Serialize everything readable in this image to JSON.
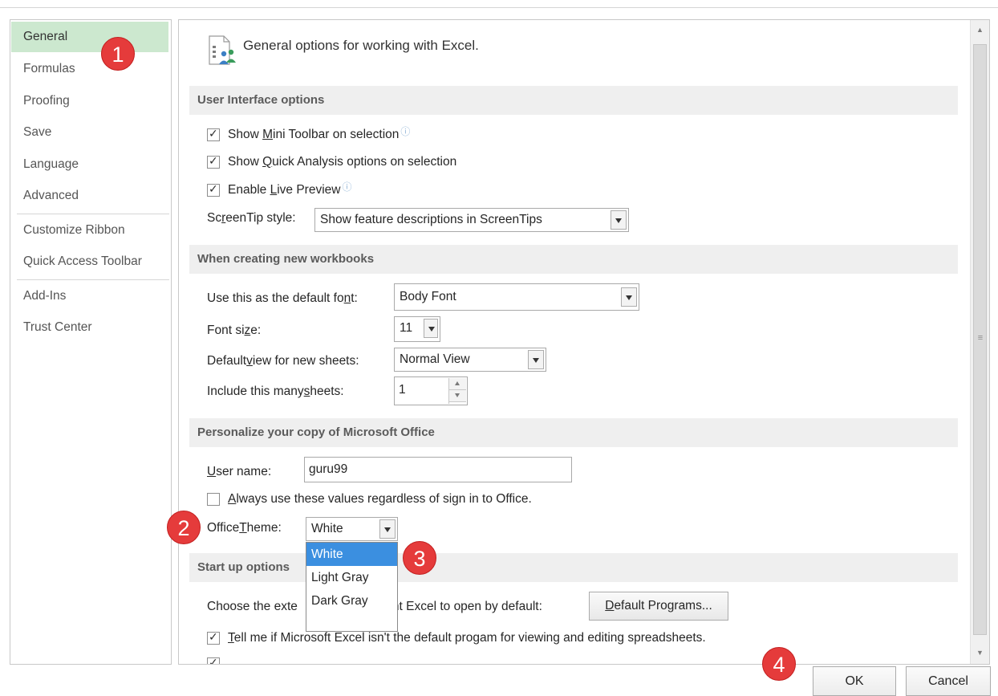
{
  "sidebar": {
    "items": [
      {
        "label": "General"
      },
      {
        "label": "Formulas"
      },
      {
        "label": "Proofing"
      },
      {
        "label": "Save"
      },
      {
        "label": "Language"
      },
      {
        "label": "Advanced"
      },
      {
        "label": "Customize Ribbon"
      },
      {
        "label": "Quick Access Toolbar"
      },
      {
        "label": "Add-Ins"
      },
      {
        "label": "Trust Center"
      }
    ],
    "selected": "General"
  },
  "header": {
    "title": "General options for working with Excel."
  },
  "sections": {
    "ui": "User Interface options",
    "workbooks": "When creating new workbooks",
    "personalize": "Personalize your copy of Microsoft Office",
    "startup": "Start up options"
  },
  "ui_options": {
    "mini_toolbar": {
      "pre": "Show ",
      "u": "M",
      "post": "ini Toolbar on selection",
      "checked": true
    },
    "quick_analysis": {
      "pre": "Show ",
      "u": "Q",
      "post": "uick Analysis options on selection",
      "checked": true
    },
    "live_preview": {
      "pre": "Enable ",
      "u": "L",
      "post": "ive Preview",
      "checked": true
    },
    "screentip_label_pre": "Sc",
    "screentip_label_u": "r",
    "screentip_label_post": "eenTip style:",
    "screentip_value": "Show feature descriptions in ScreenTips"
  },
  "workbook_options": {
    "font_label_pre": "Use this as the default fo",
    "font_label_u": "n",
    "font_label_post": "t:",
    "font_value": "Body Font",
    "size_label_pre": "Font si",
    "size_label_u": "z",
    "size_label_post": "e:",
    "size_value": "11",
    "view_label_pre": "Default ",
    "view_label_u": "v",
    "view_label_post": "iew for new sheets:",
    "view_value": "Normal View",
    "sheets_label_pre": "Include this many ",
    "sheets_label_u": "s",
    "sheets_label_post": "heets:",
    "sheets_value": "1"
  },
  "personalize": {
    "username_label_u": "U",
    "username_label_post": "ser name:",
    "username_value": "guru99",
    "always_use_u": "A",
    "always_use_post": "lways use these values regardless of sign in to Office.",
    "always_use_checked": false,
    "theme_label_pre": "Office ",
    "theme_label_u": "T",
    "theme_label_post": "heme:",
    "theme_value": "White",
    "theme_options": [
      "White",
      "Light Gray",
      "Dark Gray"
    ]
  },
  "startup": {
    "choose_ext_pre": "Choose the exte",
    "choose_ext_post": "nt Excel to open by default:",
    "default_programs_u": "D",
    "default_programs_post": "efault Programs...",
    "tell_me_u": "T",
    "tell_me_post": "ell me if Microsoft Excel isn't the default progam for viewing and editing spreadsheets.",
    "tell_me_checked": true
  },
  "footer": {
    "ok": "OK",
    "cancel": "Cancel"
  },
  "badges": [
    "1",
    "2",
    "3",
    "4"
  ],
  "colors": {
    "selected_nav": "#cce8cf",
    "badge": "#e53b3b",
    "dropdown_highlight": "#3b8fe0"
  }
}
